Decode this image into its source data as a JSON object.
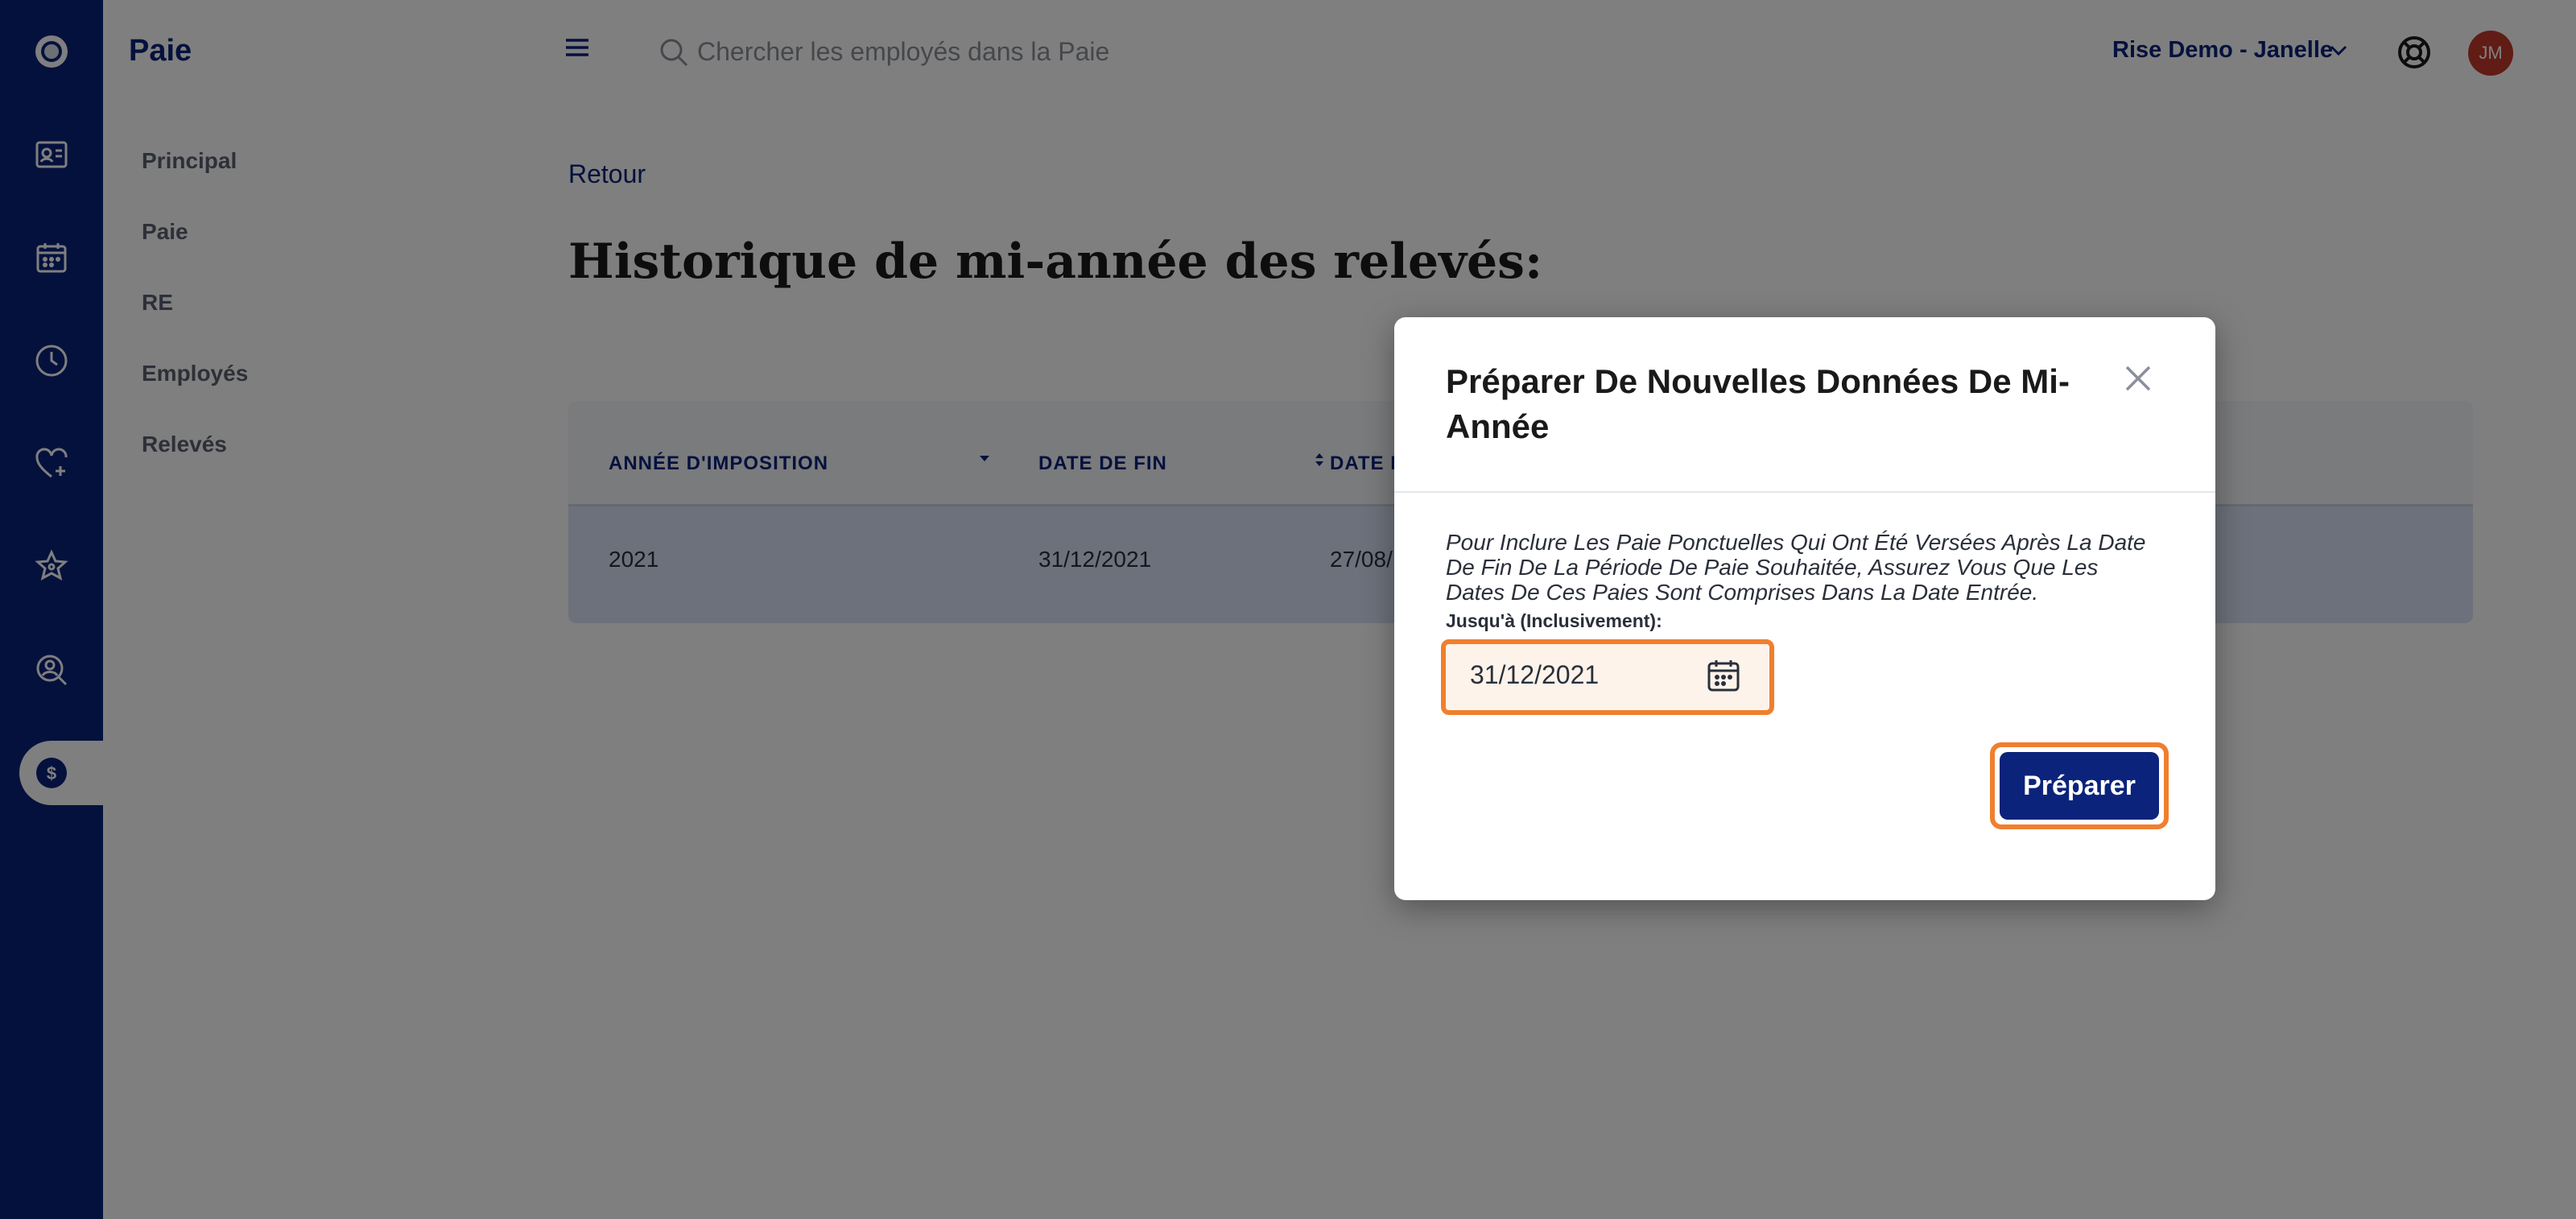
{
  "subnav": {
    "title": "Paie",
    "items": [
      {
        "label": "Principal"
      },
      {
        "label": "Paie"
      },
      {
        "label": "RE"
      },
      {
        "label": "Employés"
      },
      {
        "label": "Relevés"
      }
    ]
  },
  "rail": {
    "icons": [
      "logo-icon",
      "employee-card-icon",
      "calendar-icon",
      "clock-icon",
      "heart-plus-icon",
      "star-icon",
      "person-search-icon",
      "dollar-icon"
    ],
    "active": "dollar-icon"
  },
  "topbar": {
    "search_placeholder": "Chercher les employés dans la Paie",
    "account": "Rise Demo - Janelle",
    "avatar_initials": "JM"
  },
  "main": {
    "back_label": "Retour",
    "title": "Historique de mi-année des relevés:",
    "table": {
      "headers": [
        "ANNÉE D'IMPOSITION",
        "DATE DE FIN",
        "DATE D"
      ],
      "rows": [
        [
          "2021",
          "31/12/2021",
          "27/08/"
        ]
      ]
    }
  },
  "modal": {
    "title": "Préparer De Nouvelles Données De Mi-Année",
    "description": "Pour Inclure Les Paie Ponctuelles Qui Ont Été Versées Après La Date De Fin De La Période De Paie Souhaitée, Assurez Vous Que Les Dates De Ces Paies Sont Comprises Dans La Date Entrée.",
    "field_label": "Jusqu'à (Inclusivement):",
    "date_value": "31/12/2021",
    "prepare_label": "Préparer"
  },
  "colors": {
    "brand": "#0b237b",
    "highlight": "#f07f2e",
    "avatar": "#c0392b"
  }
}
